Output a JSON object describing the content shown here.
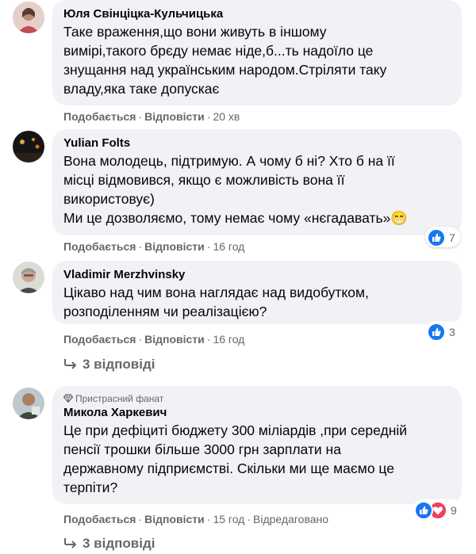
{
  "comments": [
    {
      "author": "Юля Свінціцка-Кульчицька",
      "text": "Таке враження,що вони живуть в іншому\nвимірі,такого брєду немає ніде,б...ть надоїло це\nзнущання над українським народом.Стріляти таку\nвладу,яка таке допускає",
      "like_label": "Подобається",
      "reply_label": "Відповісти",
      "time": "20 хв"
    },
    {
      "author": "Yulian Folts",
      "text": "Вона молодець, підтримую. А чому б ні? Хто б на її\nмісці відмовився, якщо є можливість вона її\nвикористовує)\nМи це дозволяємо, тому немає чому «нєгадавать»😁",
      "like_label": "Подобається",
      "reply_label": "Відповісти",
      "time": "16 год",
      "reaction_count": "7"
    },
    {
      "author": "Vladimir Merzhvinsky",
      "text": "Цікаво над чим вона наглядає над видобутком,\nрозподіленням чи реалізацією?",
      "like_label": "Подобається",
      "reply_label": "Відповісти",
      "time": "16 год",
      "reaction_count": "3",
      "replies_label": "3 відповіді"
    },
    {
      "badge": "Пристрасний фанат",
      "author": "Микола Харкевич",
      "text": "Це при дефіциті бюджету 300 міліардів ,при середній\nпенсії трошки більше 3000 грн зарплати на\nдержавному підприємстві. Скільки ми ще маємо це\nтерпіти?",
      "like_label": "Подобається",
      "reply_label": "Відповісти",
      "time": "15 год",
      "edited_label": "Відредаговано",
      "reaction_count": "9",
      "replies_label": "3 відповіді"
    }
  ],
  "colors": {
    "bubble": "#f0f2f5",
    "secondary_text": "#65676b",
    "like_blue": "#1877f2",
    "love_red": "#f33e58"
  },
  "icons": [
    "like-icon",
    "love-icon",
    "reply-arrow-icon",
    "diamond-badge-icon"
  ]
}
